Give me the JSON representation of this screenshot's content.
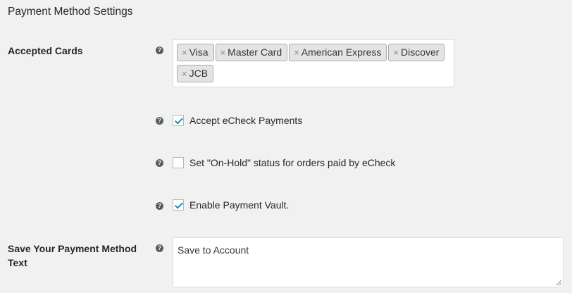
{
  "section": {
    "title": "Payment Method Settings"
  },
  "accepted_cards": {
    "label": "Accepted Cards",
    "remove_symbol": "×",
    "chips": [
      "Visa",
      "Master Card",
      "American Express",
      "Discover",
      "JCB"
    ]
  },
  "help_icon": {
    "symbol": "?",
    "name": "help-icon"
  },
  "echeck": {
    "label": "Accept eCheck Payments",
    "checked": true
  },
  "on_hold": {
    "label": "Set \"On-Hold\" status for orders paid by eCheck",
    "checked": false
  },
  "vault": {
    "label": "Enable Payment Vault.",
    "checked": true
  },
  "save_text": {
    "label": "Save Your Payment Method Text",
    "value": "Save to Account"
  },
  "colors": {
    "background": "#f1f1f1",
    "check": "#1e8cbe",
    "chip_bg": "#e4e4e4"
  }
}
